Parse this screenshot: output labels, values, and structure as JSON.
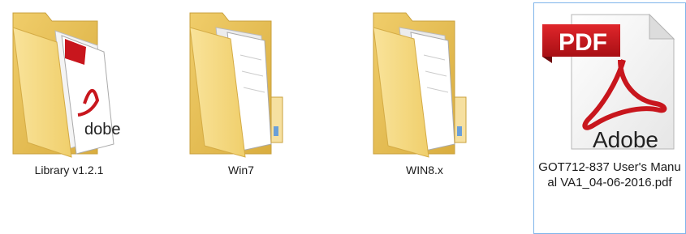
{
  "explorer": {
    "items": [
      {
        "label": "Library  v1.2.1",
        "icon": "folder-with-pdf-icon",
        "selected": false
      },
      {
        "label": "Win7",
        "icon": "folder-icon",
        "selected": false
      },
      {
        "label": "WIN8.x",
        "icon": "folder-icon",
        "selected": false
      },
      {
        "label": "GOT712-837 User's Manual VA1_04-06-2016.pdf",
        "icon": "pdf-file-icon",
        "selected": true,
        "badge_text": "PDF",
        "brand_text": "Adobe"
      }
    ],
    "colors": {
      "folder_back": "#e8c15a",
      "folder_front": "#f6db85",
      "pdf_red": "#c8161d",
      "selection_border": "#7eb4ea"
    }
  }
}
